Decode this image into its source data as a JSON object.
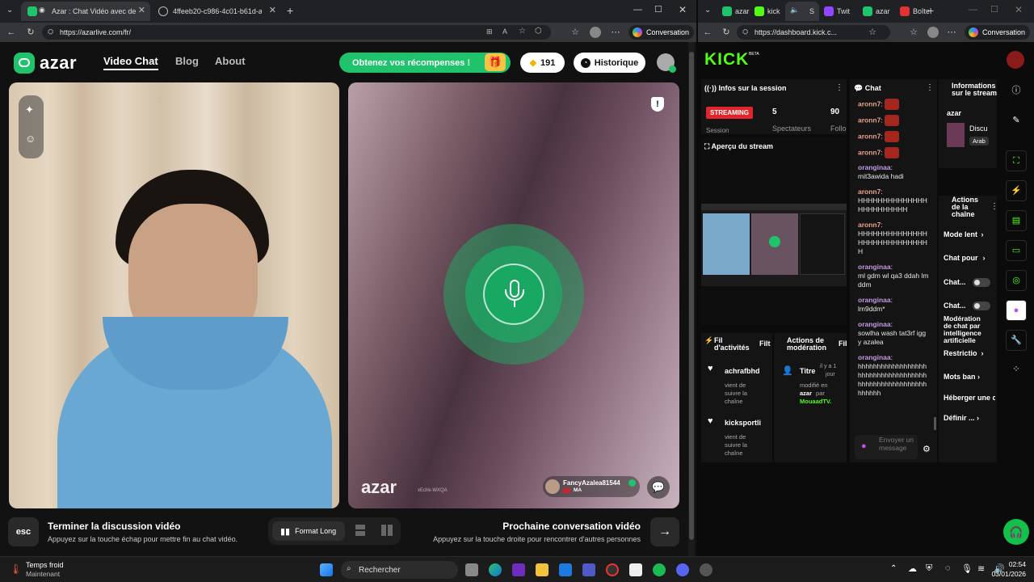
{
  "left_browser": {
    "tabs": [
      {
        "title": "Azar : Chat Vidéo avec de no"
      },
      {
        "title": "4ffeeb20-c986-4c01-b61d-aca64a"
      }
    ],
    "url": "https://azarlive.com/fr/",
    "conversation_label": "Conversation"
  },
  "azar": {
    "logo_text": "azar",
    "nav": {
      "video_chat": "Video Chat",
      "blog": "Blog",
      "about": "About"
    },
    "rewards_label": "Obtenez vos récompenses !",
    "gems_count": "191",
    "history_label": "Historique",
    "partner": {
      "watermark": "azar",
      "id": "xEchk-WXQA",
      "name": "FancyAzalea81544",
      "country": "MA"
    },
    "bottom": {
      "esc_key": "esc",
      "end_title": "Terminer la discussion vidéo",
      "end_desc": "Appuyez sur la touche échap pour mettre fin au chat vidéo.",
      "format_label": "Format Long",
      "next_title": "Prochaine conversation vidéo",
      "next_desc": "Appuyez sur la touche droite pour rencontrer d'autres personnes"
    }
  },
  "right_browser": {
    "tabs": [
      "azar",
      "kick",
      "S",
      "Twit",
      "azar",
      "Boîte"
    ],
    "url": "https://dashboard.kick.c...",
    "conversation_label": "Conversation"
  },
  "kick": {
    "logo": "KICK",
    "beta": "BETA",
    "session": {
      "title": "Infos sur la session",
      "status": "STREAMING",
      "viewers": "5",
      "followers": "90",
      "session_label": "Session",
      "viewers_label": "Spectateurs",
      "followers_label": "Follo"
    },
    "preview_title": "Aperçu du stream",
    "activity": {
      "title_line1": "Fil",
      "title_line2": "d'activités",
      "filter": "Filt",
      "items": [
        {
          "user": "achrafbhd",
          "text1": "vient de",
          "text2": "suivre la",
          "text3": "chaîne"
        },
        {
          "user": "kicksportli",
          "text1": "vient de",
          "text2": "suivre la",
          "text3": "chaîne"
        }
      ]
    },
    "moderation": {
      "title_line1": "Actions de",
      "title_line2": "modération",
      "filter": "Filt",
      "item_title": "Titre",
      "time1": "il y a 1",
      "time2": "jour",
      "l1": "modifié en",
      "l2": "azar",
      "l3": "par",
      "l4": "MouaadTV."
    },
    "chat": {
      "title": "Chat",
      "messages": [
        {
          "user": "aronn7",
          "text": ""
        },
        {
          "user": "aronn7",
          "text": ""
        },
        {
          "user": "aronn7",
          "text": ""
        },
        {
          "user": "aronn7",
          "text": ""
        },
        {
          "user": "oranginaa",
          "text": "mit3awida hadi"
        },
        {
          "user": "aronn7",
          "text": "HHHHHHHHHHHHHHHHHHHHHHHH"
        },
        {
          "user": "aronn7",
          "text": "HHHHHHHHHHHHHHHHHHHHHHHHHHHHH"
        },
        {
          "user": "oranginaa",
          "text": "ml gdm wl qa3 ddah lmddm"
        },
        {
          "user": "oranginaa",
          "text": "lm9ddm*"
        },
        {
          "user": "oranginaa",
          "text": "sowlha wash tat3rf iggy azalea"
        },
        {
          "user": "oranginaa",
          "text": "hhhhhhhhhhhhhhhhhhhhhhhhhhhhhhhhhhhhhhhhhhhhhhhhhhhhhhhhhhhh"
        }
      ],
      "input_placeholder": "Envoyer un message"
    },
    "stream_info": {
      "title_line1": "Informations",
      "title_line2": "sur le stream",
      "category_title": "azar",
      "category": "Discu",
      "tag": "Arab"
    },
    "channel_actions": {
      "title_line1": "Actions",
      "title_line2": "de la",
      "title_line3": "chaîne",
      "items": [
        "Mode lent",
        "Chat pour",
        "Chat...",
        "Chat...",
        "Modération de chat par intelligence artificielle",
        "Restrictio",
        "Mots ban",
        "Héberger une c",
        "Définir ..."
      ]
    }
  },
  "taskbar": {
    "weather_title": "Temps froid",
    "weather_sub": "Maintenant",
    "search_placeholder": "Rechercher",
    "time": "02:54",
    "date": "03/01/2026"
  }
}
